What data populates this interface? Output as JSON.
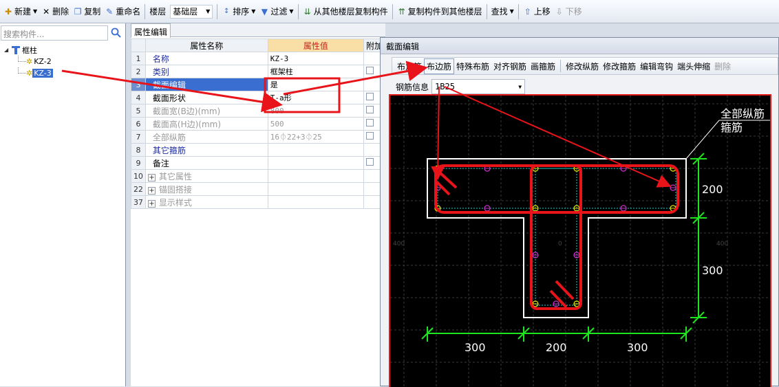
{
  "toolbar": {
    "new": "新建",
    "delete": "删除",
    "copy": "复制",
    "rename": "重命名",
    "floor_label": "楼层",
    "floor_value": "基础层",
    "sort": "排序",
    "filter": "过滤",
    "copy_from_floor": "从其他楼层复制构件",
    "copy_to_floor": "复制构件到其他楼层",
    "find": "查找",
    "move_up": "上移",
    "move_down": "下移"
  },
  "search": {
    "placeholder": "搜索构件..."
  },
  "tree": {
    "root": "框柱",
    "children": [
      {
        "label": "KZ-2"
      },
      {
        "label": "KZ-3"
      }
    ]
  },
  "property_panel": {
    "tab": "属性编辑",
    "columns": {
      "num": "",
      "name": "属性名称",
      "value": "属性值",
      "extra": "附加"
    },
    "rows": [
      {
        "num": "1",
        "name": "名称",
        "value": "KZ-3"
      },
      {
        "num": "2",
        "name": "类别",
        "value": "框架柱"
      },
      {
        "num": "3",
        "name": "截面编辑",
        "value": "是"
      },
      {
        "num": "4",
        "name": "截面形状",
        "value": "T-a形"
      },
      {
        "num": "5",
        "name": "截面宽(B边)(mm)",
        "value": "800"
      },
      {
        "num": "6",
        "name": "截面高(H边)(mm)",
        "value": "500"
      },
      {
        "num": "7",
        "name": "全部纵筋",
        "value": "16⏀22+3⏀25"
      },
      {
        "num": "8",
        "name": "其它箍筋",
        "value": ""
      },
      {
        "num": "9",
        "name": "备注",
        "value": ""
      },
      {
        "num": "10",
        "name": "其它属性",
        "value": ""
      },
      {
        "num": "22",
        "name": "锚固搭接",
        "value": ""
      },
      {
        "num": "37",
        "name": "显示样式",
        "value": ""
      }
    ]
  },
  "dialog": {
    "title": "截面编辑",
    "tools": [
      "布角筋",
      "布边筋",
      "特殊布筋",
      "对齐钢筋",
      "画箍筋",
      "修改纵筋",
      "修改箍筋",
      "编辑弯钩",
      "端头伸缩",
      "删除"
    ],
    "rebar_info_label": "钢筋信息",
    "rebar_info_value": "1B25",
    "canvas": {
      "legend_top": "全部纵筋",
      "legend_second": "箍筋",
      "dim_vertical": [
        "200",
        "300"
      ],
      "dim_horizontal": [
        "300",
        "200",
        "300"
      ],
      "axis_left": "400",
      "axis_center": "0",
      "axis_right": "400"
    }
  },
  "colors": {
    "annotation_red": "#e8141a",
    "dimension_green": "#1ee61e",
    "rebar_yellow": "#e6e600",
    "rebar_magenta": "#cc33cc"
  }
}
